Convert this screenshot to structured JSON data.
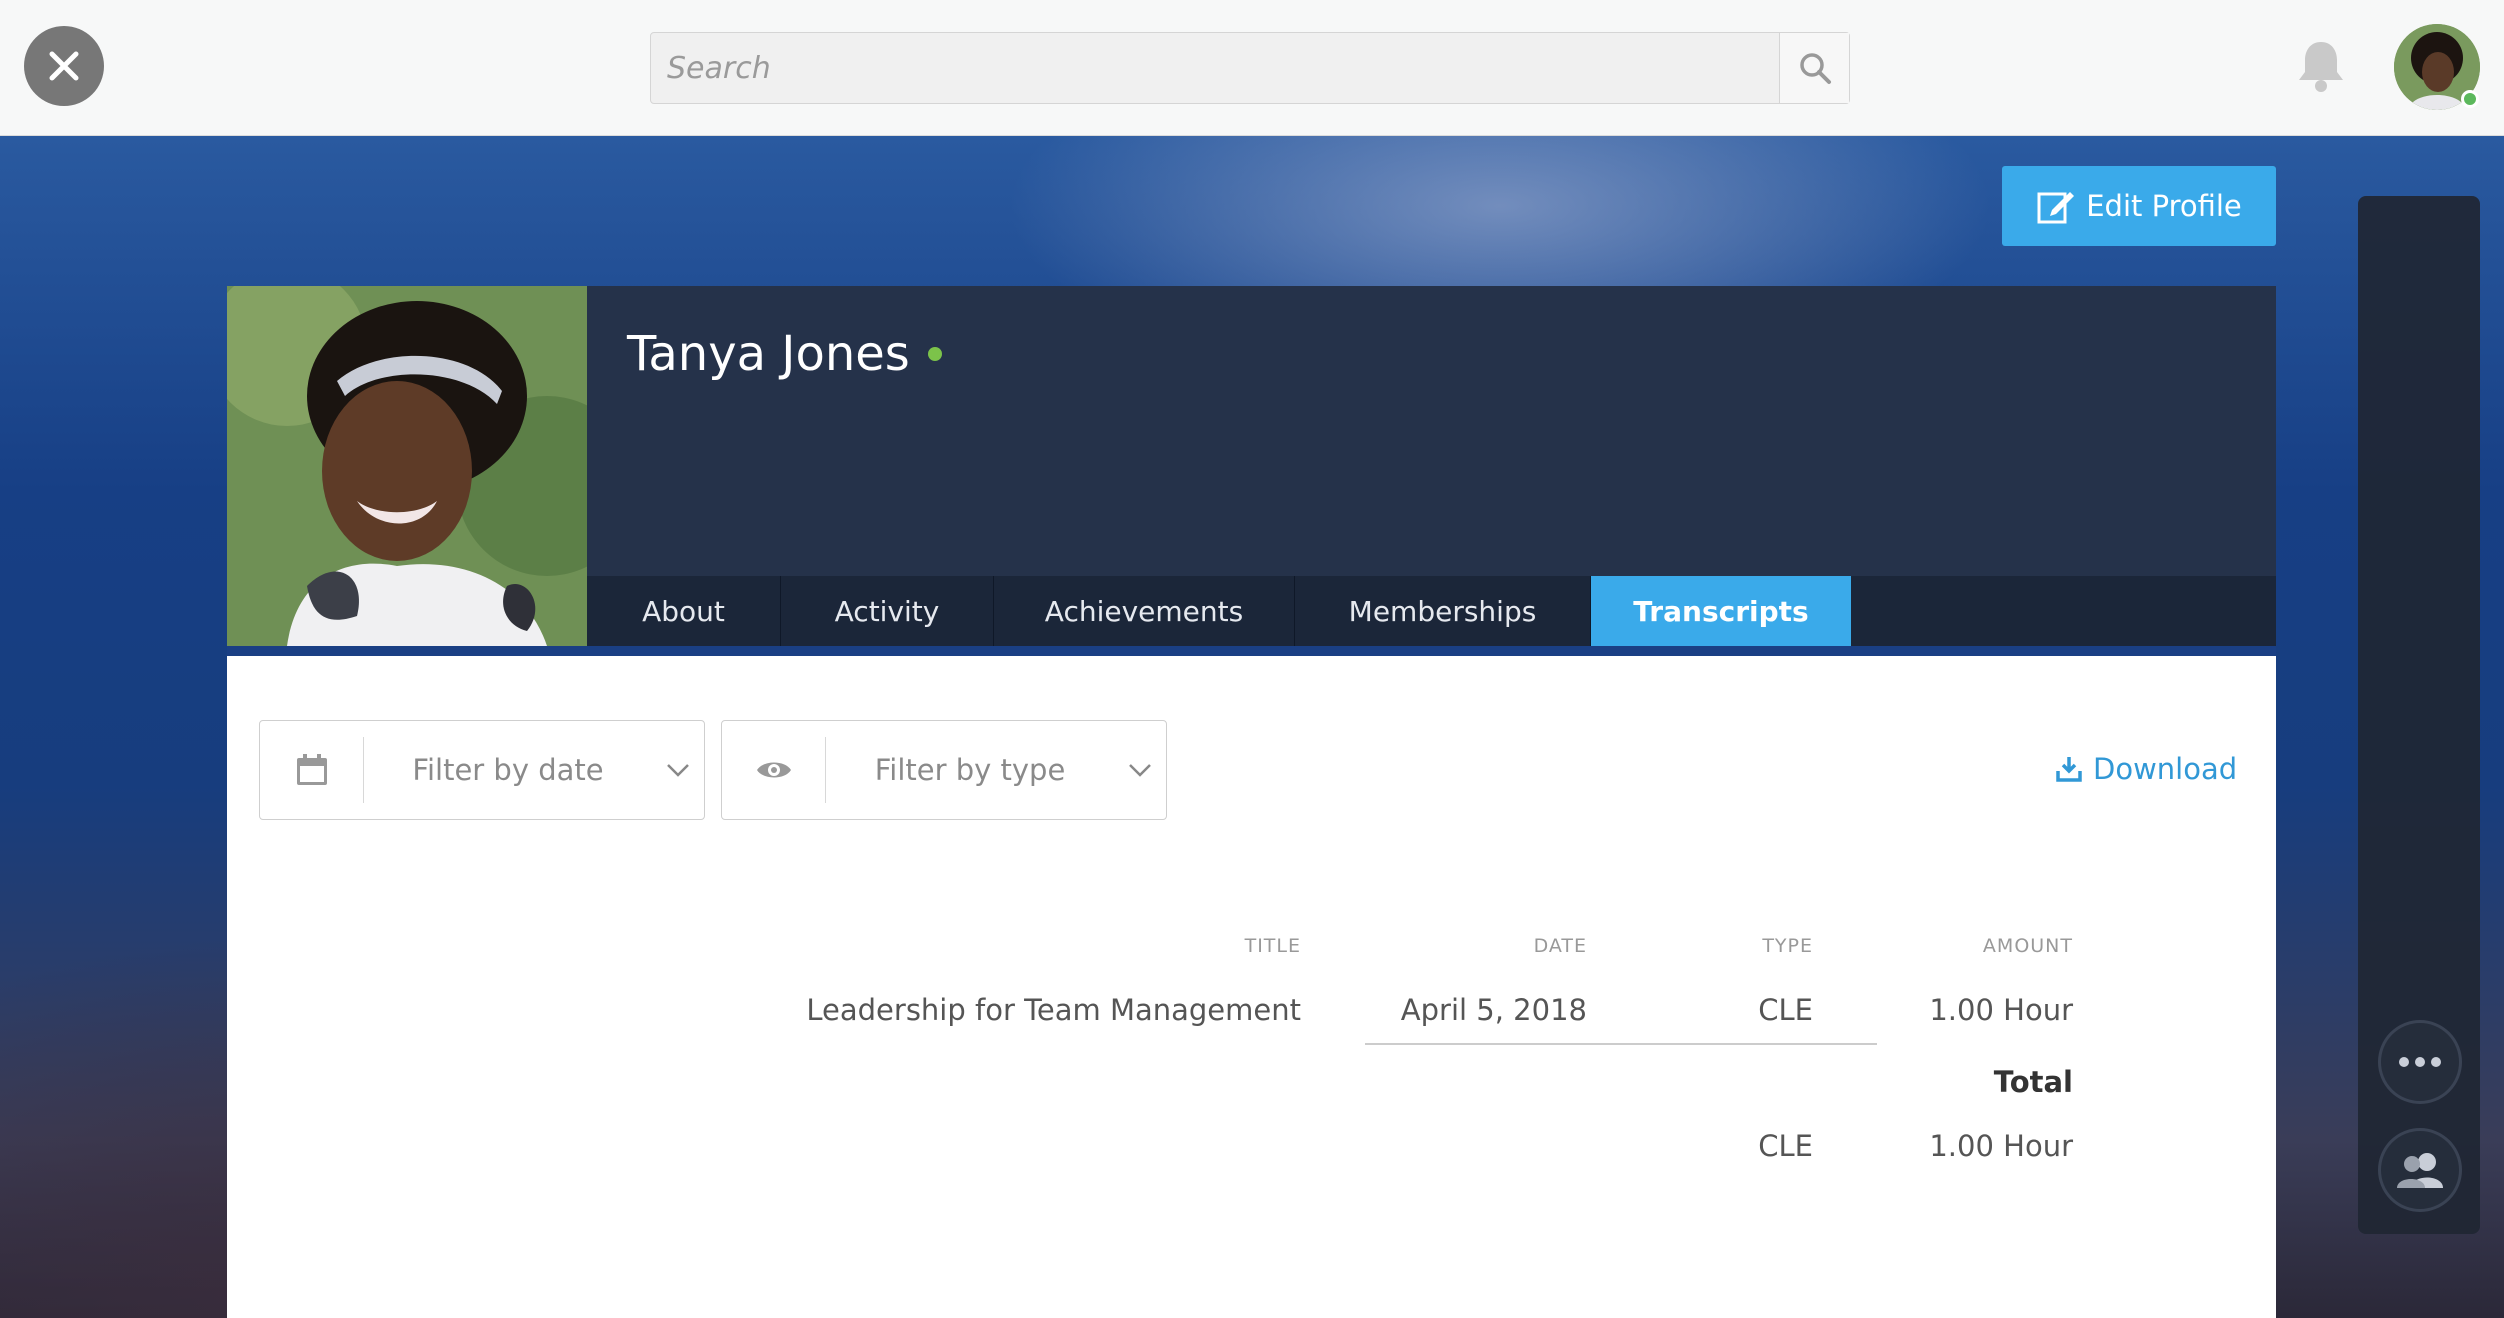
{
  "topbar": {
    "search_placeholder": "Search"
  },
  "profile": {
    "name": "Tanya Jones",
    "online": true,
    "edit_label": "Edit Profile"
  },
  "tabs": [
    {
      "label": "About",
      "active": false
    },
    {
      "label": "Activity",
      "active": false
    },
    {
      "label": "Achievements",
      "active": false
    },
    {
      "label": "Memberships",
      "active": false
    },
    {
      "label": "Transcripts",
      "active": true
    }
  ],
  "filters": {
    "date_label": "Filter by date",
    "type_label": "Filter by type"
  },
  "download_label": "Download",
  "table": {
    "headers": {
      "title": "TITLE",
      "date": "DATE",
      "type": "TYPE",
      "amount": "AMOUNT"
    },
    "rows": [
      {
        "title": "Leadership for Team Management",
        "date": "April 5, 2018",
        "type": "CLE",
        "amount": "1.00 Hour"
      }
    ],
    "total_label": "Total",
    "totals": [
      {
        "type": "CLE",
        "amount": "1.00 Hour"
      }
    ]
  },
  "colors": {
    "accent": "#3aaaea",
    "online": "#7cc34a",
    "header_bg": "#25324a"
  }
}
